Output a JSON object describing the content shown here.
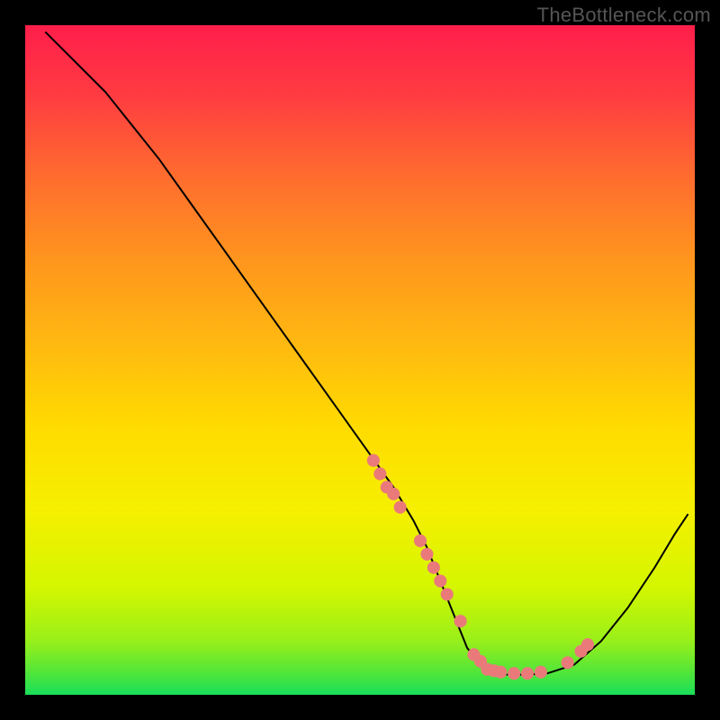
{
  "watermark": "TheBottleneck.com",
  "chart_data": {
    "type": "line",
    "title": "",
    "xlabel": "",
    "ylabel": "",
    "xlim": [
      0,
      100
    ],
    "ylim": [
      0,
      100
    ],
    "legend": false,
    "grid": false,
    "background_gradient": {
      "top": "#ff1e4b",
      "mid": "#ffdb00",
      "bottom": "#19de59"
    },
    "series": [
      {
        "name": "bottleneck-curve",
        "color": "#000000",
        "type": "line",
        "x": [
          3,
          5,
          8,
          12,
          16,
          20,
          25,
          30,
          35,
          40,
          45,
          50,
          55,
          58,
          60,
          62,
          64,
          66,
          68,
          70,
          72,
          75,
          78,
          82,
          86,
          90,
          94,
          97,
          99
        ],
        "y": [
          99,
          97,
          94,
          90,
          85,
          80,
          73,
          66,
          59,
          52,
          45,
          38,
          31,
          26,
          22,
          17,
          12,
          7,
          4.5,
          3.5,
          3,
          3,
          3.2,
          4.5,
          8,
          13,
          19,
          24,
          27
        ]
      },
      {
        "name": "bottleneck-points",
        "color": "#ea7a7a",
        "type": "scatter",
        "x": [
          52,
          53,
          54,
          55,
          56,
          59,
          60,
          61,
          62,
          63,
          65,
          67,
          68,
          69,
          70,
          71,
          73,
          75,
          77,
          81,
          83,
          84
        ],
        "y": [
          35,
          33,
          31,
          30,
          28,
          23,
          21,
          19,
          17,
          15,
          11,
          6,
          5,
          3.8,
          3.6,
          3.4,
          3.2,
          3.2,
          3.4,
          4.8,
          6.5,
          7.5
        ]
      }
    ]
  },
  "gradient_stops": [
    {
      "offset": "0%",
      "color": "#ff1e4b"
    },
    {
      "offset": "10%",
      "color": "#ff3a42"
    },
    {
      "offset": "22%",
      "color": "#ff6a2f"
    },
    {
      "offset": "35%",
      "color": "#ff951e"
    },
    {
      "offset": "48%",
      "color": "#ffba10"
    },
    {
      "offset": "60%",
      "color": "#ffdb00"
    },
    {
      "offset": "72%",
      "color": "#f6ef00"
    },
    {
      "offset": "84%",
      "color": "#d4f600"
    },
    {
      "offset": "92%",
      "color": "#98ef1a"
    },
    {
      "offset": "97%",
      "color": "#4ce53c"
    },
    {
      "offset": "100%",
      "color": "#19de59"
    }
  ]
}
